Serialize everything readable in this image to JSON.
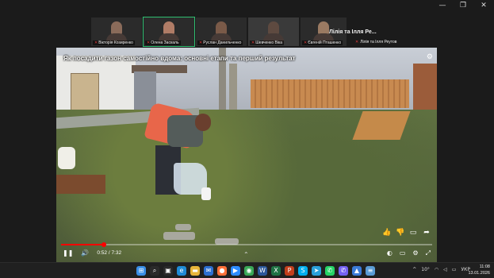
{
  "window": {
    "controls": [
      "—",
      "❐",
      "✕"
    ]
  },
  "participants": [
    {
      "name": "Вікторія Козиренко",
      "muted": true,
      "active": false
    },
    {
      "name": "Олена Заскаль",
      "muted": true,
      "active": true
    },
    {
      "name": "Руслан Данильченко",
      "muted": true,
      "active": false
    },
    {
      "name": "Шевченко Віка",
      "muted": true,
      "active": false
    },
    {
      "name": "Євгеній Пташенко",
      "muted": true,
      "active": false
    }
  ],
  "featured": {
    "title": "Лілія та Ілля Ре...",
    "subname": "Лілія та Ілля Реутов"
  },
  "video": {
    "title": "Як посадити газон самостійно вдома: основні етапи та перший результат",
    "time": "0:52 / 7:32",
    "progress": 0.115
  },
  "taskbar": {
    "icons": [
      {
        "name": "windows-start-icon",
        "glyph": "⊞",
        "color": "#3a8ee6"
      },
      {
        "name": "search-icon",
        "glyph": "⌕",
        "color": "#2a2a2a"
      },
      {
        "name": "task-view-icon",
        "glyph": "▣",
        "color": "#2a2a2a"
      },
      {
        "name": "edge-icon",
        "glyph": "e",
        "color": "#1f8bd6"
      },
      {
        "name": "file-explorer-icon",
        "glyph": "▬",
        "color": "#e8b53a"
      },
      {
        "name": "mail-icon",
        "glyph": "✉",
        "color": "#2d6fd0"
      },
      {
        "name": "firefox-icon",
        "glyph": "●",
        "color": "#ff7139"
      },
      {
        "name": "zoom-icon",
        "glyph": "▶",
        "color": "#2d8cff"
      },
      {
        "name": "chrome-icon",
        "glyph": "◉",
        "color": "#3aa757"
      },
      {
        "name": "word-icon",
        "glyph": "W",
        "color": "#2b579a"
      },
      {
        "name": "excel-icon",
        "glyph": "X",
        "color": "#1f7244"
      },
      {
        "name": "powerpoint-icon",
        "glyph": "P",
        "color": "#c43e1c"
      },
      {
        "name": "skype-icon",
        "glyph": "S",
        "color": "#00aff0"
      },
      {
        "name": "telegram-icon",
        "glyph": "➤",
        "color": "#2aa0da"
      },
      {
        "name": "whatsapp-icon",
        "glyph": "✆",
        "color": "#25d366"
      },
      {
        "name": "viber-icon",
        "glyph": "✆",
        "color": "#7360f2"
      },
      {
        "name": "photos-icon",
        "glyph": "▲",
        "color": "#3b7bd8"
      },
      {
        "name": "notepad-icon",
        "glyph": "≡",
        "color": "#5a9bd5"
      }
    ],
    "tray": {
      "chevron": "^",
      "temperature": "10°",
      "lang": "УКР"
    },
    "clock": {
      "time": "11:08",
      "date": "13.01.2026"
    }
  }
}
